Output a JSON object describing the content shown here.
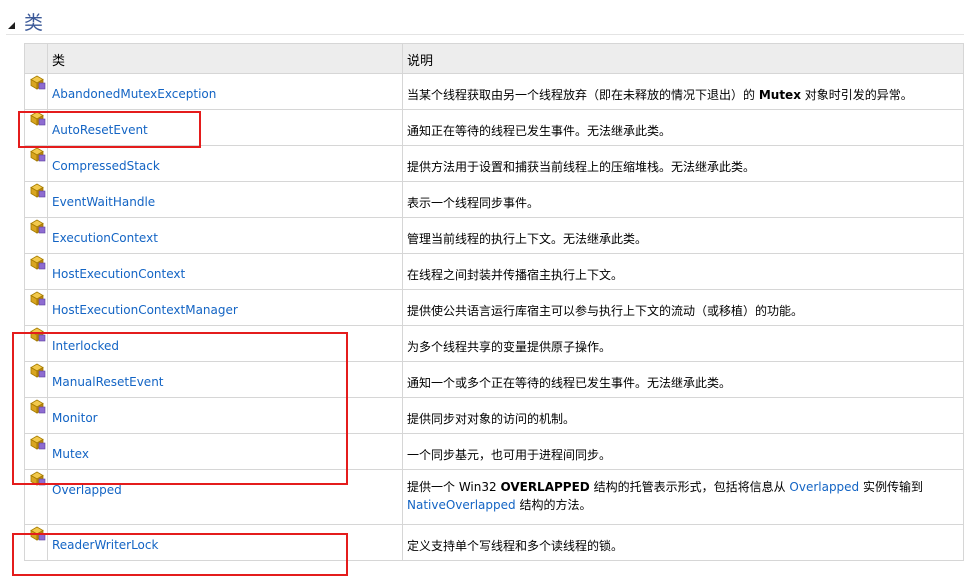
{
  "section": {
    "title": "类"
  },
  "table": {
    "headers": {
      "name": "类",
      "description": "说明"
    },
    "rows": [
      {
        "name": "AbandonedMutexException",
        "desc": [
          "当某个线程获取由另一个线程放弃（即在未释放的情况下退出）的 ",
          "Mutex",
          " 对象时引发的异常。"
        ]
      },
      {
        "name": "AutoResetEvent",
        "desc": [
          "通知正在等待的线程已发生事件。无法继承此类。"
        ]
      },
      {
        "name": "CompressedStack",
        "desc": [
          "提供方法用于设置和捕获当前线程上的压缩堆栈。无法继承此类。"
        ]
      },
      {
        "name": "EventWaitHandle",
        "desc": [
          "表示一个线程同步事件。"
        ]
      },
      {
        "name": "ExecutionContext",
        "desc": [
          "管理当前线程的执行上下文。无法继承此类。"
        ]
      },
      {
        "name": "HostExecutionContext",
        "desc": [
          "在线程之间封装并传播宿主执行上下文。"
        ]
      },
      {
        "name": "HostExecutionContextManager",
        "desc": [
          "提供使公共语言运行库宿主可以参与执行上下文的流动（或移植）的功能。"
        ]
      },
      {
        "name": "Interlocked",
        "desc": [
          "为多个线程共享的变量提供原子操作。"
        ]
      },
      {
        "name": "ManualResetEvent",
        "desc": [
          "通知一个或多个正在等待的线程已发生事件。无法继承此类。"
        ]
      },
      {
        "name": "Monitor",
        "desc": [
          "提供同步对对象的访问的机制。"
        ]
      },
      {
        "name": "Mutex",
        "desc": [
          "一个同步基元，也可用于进程间同步。"
        ]
      },
      {
        "name": "Overlapped",
        "desc": [
          "提供一个 Win32 ",
          "OVERLAPPED",
          " 结构的托管表示形式，包括将信息从 ",
          "Overlapped",
          " 实例传输到 ",
          "NativeOverlapped",
          " 结构的方法。"
        ]
      },
      {
        "name": "ReaderWriterLock",
        "desc": [
          "定义支持单个写线程和多个读线程的锁。"
        ]
      }
    ]
  },
  "colors": {
    "link": "#1364c4",
    "highlight": "#e41c1c",
    "title": "#3b5998"
  }
}
